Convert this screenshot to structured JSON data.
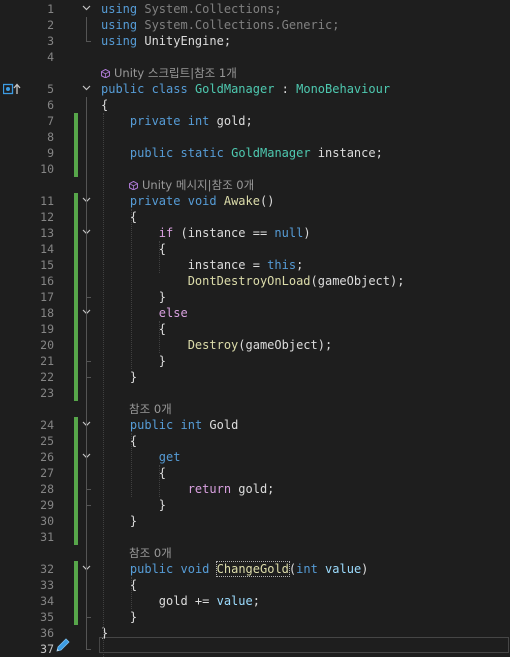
{
  "editor": {
    "lines": [
      {
        "n": "1",
        "fold": "v",
        "html": "<span class=\"kw\">using</span> <span class=\"dim\">System.Collections;</span>"
      },
      {
        "n": "2",
        "fold": "",
        "html": "<span class=\"kw\">using</span> <span class=\"dim\">System.Collections.Generic;</span>"
      },
      {
        "n": "3",
        "fold": "",
        "html": "<span class=\"kw\">using</span> <span class=\"pl\">UnityEngine;</span>"
      },
      {
        "n": "4",
        "fold": "",
        "html": ""
      },
      {
        "lens": "Unity 스크립트|참조 1개",
        "cube": true,
        "indent": 0
      },
      {
        "n": "5",
        "fold": "v",
        "marker": true,
        "html": "<span class=\"kw\">public</span> <span class=\"kw\">class</span> <span class=\"ty\">GoldManager</span> : <span class=\"ty\">MonoBehaviour</span>"
      },
      {
        "n": "6",
        "fold": "",
        "html": "{"
      },
      {
        "n": "7",
        "fold": "",
        "chg": true,
        "html": "    <span class=\"kw\">private</span> <span class=\"kw\">int</span> gold;"
      },
      {
        "n": "8",
        "fold": "",
        "chg": true,
        "html": ""
      },
      {
        "n": "9",
        "fold": "",
        "chg": true,
        "html": "    <span class=\"kw\">public</span> <span class=\"kw\">static</span> <span class=\"ty\">GoldManager</span> instance;"
      },
      {
        "n": "10",
        "fold": "",
        "chg": true,
        "html": ""
      },
      {
        "lens": "Unity 메시지|참조 0개",
        "cube": true,
        "indent": 4
      },
      {
        "n": "11",
        "fold": "v",
        "chg": true,
        "html": "    <span class=\"kw\">private</span> <span class=\"kw\">void</span> <span class=\"me\">Awake</span>()"
      },
      {
        "n": "12",
        "fold": "",
        "chg": true,
        "html": "    {"
      },
      {
        "n": "13",
        "fold": "v",
        "chg": true,
        "html": "        <span class=\"ctl\">if</span> (instance == <span class=\"kw\">null</span>)"
      },
      {
        "n": "14",
        "fold": "",
        "chg": true,
        "html": "        {"
      },
      {
        "n": "15",
        "fold": "",
        "chg": true,
        "html": "            instance = <span class=\"kw\">this</span>;"
      },
      {
        "n": "16",
        "fold": "",
        "chg": true,
        "html": "            <span class=\"me\">DontDestroyOnLoad</span>(gameObject);"
      },
      {
        "n": "17",
        "fold": "",
        "chg": true,
        "html": "        }"
      },
      {
        "n": "18",
        "fold": "v",
        "chg": true,
        "html": "        <span class=\"ctl\">else</span>"
      },
      {
        "n": "19",
        "fold": "",
        "chg": true,
        "html": "        {"
      },
      {
        "n": "20",
        "fold": "",
        "chg": true,
        "html": "            <span class=\"me\">Destroy</span>(gameObject);"
      },
      {
        "n": "21",
        "fold": "",
        "chg": true,
        "html": "        }"
      },
      {
        "n": "22",
        "fold": "",
        "chg": true,
        "html": "    }"
      },
      {
        "n": "23",
        "fold": "",
        "chg": true,
        "html": ""
      },
      {
        "lens": "참조 0개",
        "cube": false,
        "indent": 4
      },
      {
        "n": "24",
        "fold": "v",
        "chg": true,
        "html": "    <span class=\"kw\">public</span> <span class=\"kw\">int</span> Gold"
      },
      {
        "n": "25",
        "fold": "",
        "chg": true,
        "html": "    {"
      },
      {
        "n": "26",
        "fold": "v",
        "chg": true,
        "html": "        <span class=\"kw\">get</span>"
      },
      {
        "n": "27",
        "fold": "",
        "chg": true,
        "html": "        {"
      },
      {
        "n": "28",
        "fold": "",
        "chg": true,
        "html": "            <span class=\"ctl\">return</span> gold;"
      },
      {
        "n": "29",
        "fold": "",
        "chg": true,
        "html": "        }"
      },
      {
        "n": "30",
        "fold": "",
        "chg": true,
        "html": "    }"
      },
      {
        "n": "31",
        "fold": "",
        "chg": true,
        "html": ""
      },
      {
        "lens": "참조 0개",
        "cube": false,
        "indent": 4
      },
      {
        "n": "32",
        "fold": "v",
        "chg": true,
        "html": "    <span class=\"kw\">public</span> <span class=\"kw\">void</span> <span class=\"me highlight-box\">ChangeGold</span>(<span class=\"kw\">int</span> <span class=\"pa\">value</span>)"
      },
      {
        "n": "33",
        "fold": "",
        "chg": true,
        "html": "    {"
      },
      {
        "n": "34",
        "fold": "",
        "chg": true,
        "html": "        gold += <span class=\"pa\">value</span>;"
      },
      {
        "n": "35",
        "fold": "",
        "chg": true,
        "html": "    }"
      },
      {
        "n": "36",
        "fold": "",
        "html": "}"
      },
      {
        "n": "37",
        "fold": "",
        "cur": true,
        "html": ""
      }
    ]
  },
  "icons": {
    "fold": "chevron-down-icon",
    "lens": "unity-cube-icon",
    "marker": "reference-marker-icon",
    "pen": "pen-icon"
  }
}
